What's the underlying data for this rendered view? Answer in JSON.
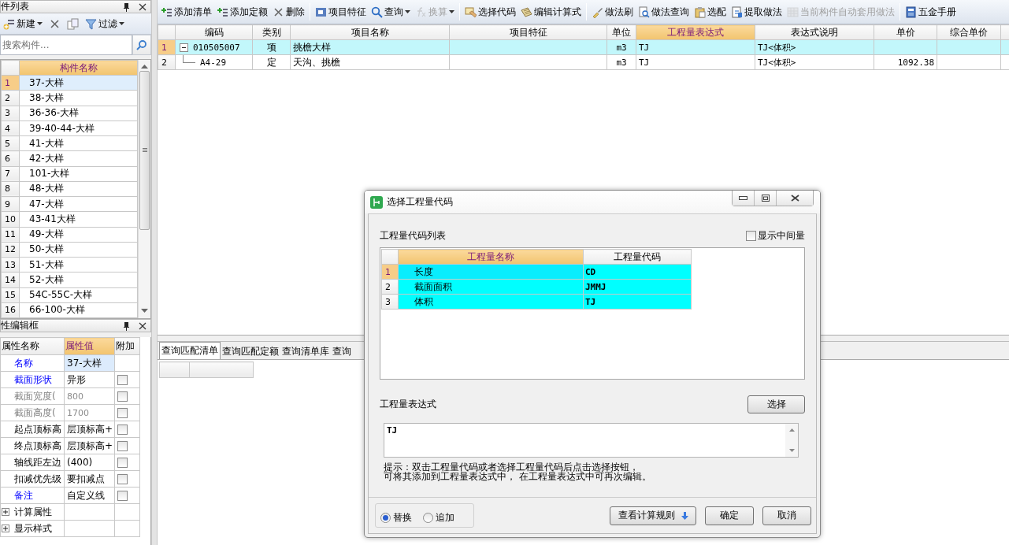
{
  "left_panel": {
    "title": "件列表",
    "toolbar": [
      {
        "kind": "new",
        "label": "新建",
        "dropdown": true
      },
      {
        "kind": "delete",
        "dropdown": false
      },
      {
        "kind": "copy",
        "dropdown": false
      },
      {
        "kind": "filter",
        "label": "过滤",
        "dropdown": true
      }
    ],
    "search": {
      "placeholder": "搜索构件..."
    },
    "list": {
      "column": {
        "label": "构件名称",
        "selected": true
      },
      "rows": [
        {
          "number": "1",
          "name": "37-大样",
          "selected": true
        },
        {
          "number": "2",
          "name": "38-大样",
          "selected": false
        },
        {
          "number": "3",
          "name": "36-36-大样",
          "selected": false
        },
        {
          "number": "4",
          "name": "39-40-44-大样",
          "selected": false
        },
        {
          "number": "5",
          "name": "41-大样",
          "selected": false
        },
        {
          "number": "6",
          "name": "42-大样",
          "selected": false
        },
        {
          "number": "7",
          "name": "101-大样",
          "selected": false
        },
        {
          "number": "8",
          "name": "48-大样",
          "selected": false
        },
        {
          "number": "9",
          "name": "47-大样",
          "selected": false
        },
        {
          "number": "10",
          "name": "43-41大样",
          "selected": false
        },
        {
          "number": "11",
          "name": "49-大样",
          "selected": false
        },
        {
          "number": "12",
          "name": "50-大样",
          "selected": false
        },
        {
          "number": "13",
          "name": "51-大样",
          "selected": false
        },
        {
          "number": "14",
          "name": "52-大样",
          "selected": false
        },
        {
          "number": "15",
          "name": "54C-55C-大样",
          "selected": false
        },
        {
          "number": "16",
          "name": "66-100-大样",
          "selected": false
        }
      ]
    }
  },
  "property_panel": {
    "title": "性编辑框",
    "columns": [
      {
        "label": "属性名称",
        "selected": false
      },
      {
        "label": "属性值",
        "selected": true
      },
      {
        "label": "附加",
        "selected": false
      }
    ],
    "rows": [
      {
        "kind": "property",
        "name": "名称",
        "value": "37-大样",
        "emphasized": true,
        "disabled": false,
        "selected": true
      },
      {
        "kind": "property",
        "name": "截面形状",
        "value": "异形",
        "emphasized": true,
        "disabled": false,
        "selected": false,
        "checked": false
      },
      {
        "kind": "property",
        "name": "截面宽度(",
        "value": "800",
        "disabled": true,
        "selected": false,
        "checked": false
      },
      {
        "kind": "property",
        "name": "截面高度(",
        "value": "1700",
        "disabled": true,
        "selected": false,
        "checked": false
      },
      {
        "kind": "property",
        "name": "起点顶标高",
        "value": "层顶标高+",
        "emphasized": false,
        "disabled": false,
        "selected": false,
        "checked": false
      },
      {
        "kind": "property",
        "name": "终点顶标高",
        "value": "层顶标高+",
        "emphasized": false,
        "disabled": false,
        "selected": false,
        "checked": false
      },
      {
        "kind": "property",
        "name": "轴线距左边",
        "value": "(400)",
        "emphasized": false,
        "disabled": false,
        "selected": false,
        "checked": false
      },
      {
        "kind": "property",
        "name": "扣减优先级",
        "value": "要扣减点",
        "emphasized": false,
        "disabled": false,
        "selected": false,
        "checked": false
      },
      {
        "kind": "property",
        "name": "备注",
        "value": "自定义线",
        "emphasized": true,
        "disabled": false,
        "selected": false,
        "checked": false
      },
      {
        "kind": "group",
        "name": "计算属性",
        "expanded": false
      },
      {
        "kind": "group",
        "name": "显示样式",
        "expanded": false
      }
    ]
  },
  "main": {
    "toolbar": [
      [
        {
          "kind": "add",
          "label": "添加清单",
          "disabled": false,
          "dropdown": false
        },
        {
          "kind": "add",
          "label": "添加定额",
          "disabled": false,
          "dropdown": false
        },
        {
          "kind": "delete",
          "label": "删除",
          "disabled": false,
          "dropdown": false
        }
      ],
      [
        {
          "kind": "feature",
          "label": "项目特征",
          "disabled": false,
          "dropdown": false
        },
        {
          "kind": "search",
          "label": "查询",
          "disabled": false,
          "dropdown": true
        },
        {
          "kind": "formula",
          "label": "换算",
          "disabled": true,
          "dropdown": true
        }
      ],
      [
        {
          "kind": "code",
          "label": "选择代码",
          "disabled": false,
          "dropdown": false
        },
        {
          "kind": "edit",
          "label": "编辑计算式",
          "disabled": false,
          "dropdown": false
        }
      ],
      [
        {
          "kind": "brush",
          "label": "做法刷",
          "disabled": false,
          "dropdown": false
        },
        {
          "kind": "query",
          "label": "做法查询",
          "disabled": false,
          "dropdown": false
        },
        {
          "kind": "config",
          "label": "选配",
          "disabled": false,
          "dropdown": false
        },
        {
          "kind": "extract",
          "label": "提取做法",
          "disabled": false,
          "dropdown": false
        },
        {
          "kind": "auto",
          "label": "当前构件自动套用做法",
          "disabled": true,
          "dropdown": false
        }
      ],
      [
        {
          "kind": "book",
          "label": "五金手册",
          "disabled": false,
          "dropdown": false
        }
      ]
    ],
    "columns": [
      {
        "label": "编码",
        "selected": false
      },
      {
        "label": "类别",
        "selected": false
      },
      {
        "label": "项目名称",
        "selected": false
      },
      {
        "label": "项目特征",
        "selected": false
      },
      {
        "label": "单位",
        "selected": false
      },
      {
        "label": "工程量表达式",
        "selected": true
      },
      {
        "label": "表达式说明",
        "selected": false
      },
      {
        "label": "单价",
        "selected": false
      },
      {
        "label": "综合单价",
        "selected": false
      }
    ],
    "rows": [
      {
        "number": "1",
        "code": "010505007",
        "type": "项",
        "name": "挑檐大样",
        "unit": "m3",
        "expression": "TJ",
        "description": "TJ<体积>",
        "selected": true,
        "expanded": true,
        "children": [
          {
            "number": "2",
            "code": "A4-29",
            "type": "定",
            "name": "天沟、挑檐",
            "unit": "m3",
            "expression": "TJ",
            "description": "TJ<体积>",
            "price": "1092.38",
            "selected": false
          }
        ]
      }
    ],
    "bottom_tabs": [
      {
        "label": "查询匹配清单",
        "selected": true
      },
      {
        "label": "查询匹配定额",
        "selected": false
      },
      {
        "label": "查询清单库",
        "selected": false
      },
      {
        "label": "查询",
        "selected": false
      }
    ]
  },
  "dialog": {
    "title": "选择工程量代码",
    "list_label": "工程量代码列表",
    "show_intermediate": {
      "label": "显示中间量",
      "checked": false
    },
    "columns": [
      {
        "label": "工程量名称",
        "selected": true
      },
      {
        "label": "工程量代码",
        "selected": false
      }
    ],
    "rows": [
      {
        "number": "1",
        "name": "长度",
        "code": "CD",
        "selected": true
      },
      {
        "number": "2",
        "name": "截面面积",
        "code": "JMMJ",
        "selected": false
      },
      {
        "number": "3",
        "name": "体积",
        "code": "TJ",
        "selected": false
      }
    ],
    "expression_label": "工程量表达式",
    "select_button": "选择",
    "expression": "TJ",
    "hint": [
      "提示：双击工程量代码或者选择工程量代码后点击选择按钮，",
      "可将其添加到工程量表达式中， 在工程量表达式中可再次编辑。"
    ],
    "modes": [
      {
        "label": "替换",
        "selected": true
      },
      {
        "label": "追加",
        "selected": false
      }
    ],
    "rules_button": "查看计算规则",
    "buttons": [
      "确定",
      "取消"
    ]
  }
}
